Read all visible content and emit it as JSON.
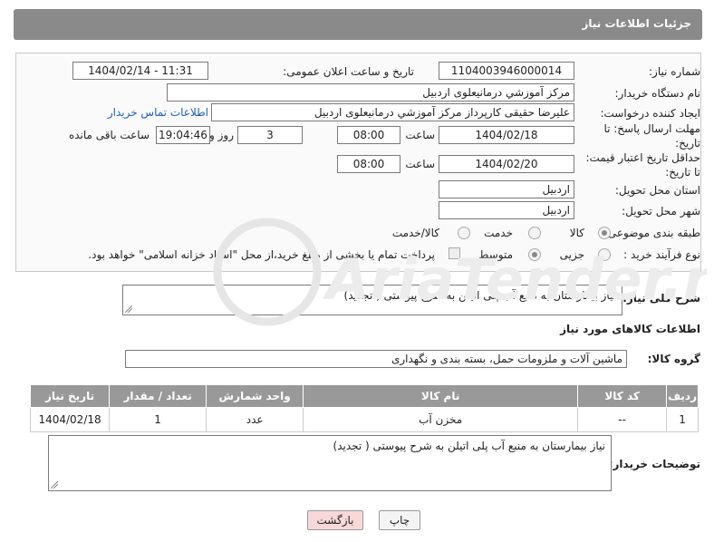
{
  "header": {
    "title": "جزئیات اطلاعات نیاز"
  },
  "form": {
    "need_number_label": "شماره نیاز:",
    "need_number": "1104003946000014",
    "announce_label": "تاریخ و ساعت اعلان عمومی:",
    "announce_value": "1404/02/14 - 11:31",
    "buyer_org_label": "نام دستگاه خریدار:",
    "buyer_org": "مرکز آموزشي درمانيعلوی اردبیل",
    "requester_label": "ایجاد کننده درخواست:",
    "requester": "علیرضا حقیقی کارپرداز مرکز آموزشي درمانيعلوی اردبیل",
    "contact_link": "اطلاعات تماس خریدار",
    "reply_deadline_label": "مهلت ارسال پاسخ: تا تاریخ:",
    "reply_date": "1404/02/18",
    "time_label": "ساعت",
    "reply_time": "08:00",
    "days": "3",
    "days_label": "روز و",
    "remaining_time": "19:04:46",
    "remaining_label": "ساعت باقی مانده",
    "price_validity_label": "حداقل تاریخ اعتبار قیمت: تا تاریخ:",
    "price_date": "1404/02/20",
    "price_time": "08:00",
    "province_label": "استان محل تحویل:",
    "province": "اردبیل",
    "city_label": "شهر محل تحویل:",
    "city": "اردبیل",
    "category_label": "طبقه بندی موضوعی:",
    "category_options": [
      "کالا",
      "خدمت",
      "کالا/خدمت"
    ],
    "process_label": "نوع فرآیند خرید :",
    "process_options": [
      "جزیی",
      "متوسط"
    ],
    "payment_note": "پرداخت تمام یا بخشی از مبلغ خرید،از محل \"اسناد خزانه اسلامی\" خواهد بود."
  },
  "description": {
    "label": "شرح کلی نیاز:",
    "text": "نیاز بیمارستان به منبع آب پلی اتیلن به شرح پیوستی ( تجدید)"
  },
  "goods": {
    "section_title": "اطلاعات کالاهای مورد نیاز",
    "group_label": "گروه کالا:",
    "group_value": "ماشین آلات و ملزومات حمل، بسته بندی و نگهداری",
    "columns": [
      "ردیف",
      "کد کالا",
      "نام کالا",
      "واحد شمارش",
      "تعداد / مقدار",
      "تاریخ نیاز"
    ],
    "rows": [
      {
        "row": "1",
        "code": "--",
        "name": "مخزن آب",
        "unit": "عدد",
        "qty": "1",
        "date": "1404/02/18"
      }
    ]
  },
  "buyer_notes": {
    "label": "توضیحات خریدار:",
    "text": "نیاز بیمارستان به منبع آب پلی اتیلن به شرح پیوستی ( تجدید)"
  },
  "buttons": {
    "print": "چاپ",
    "back": "بازگشت"
  },
  "watermark": {
    "text": "AriaTender.neT"
  },
  "colors": {
    "header": "#8a8a8a",
    "table_header": "#999999",
    "link": "#2060b0",
    "back_button": "#f8d8d8"
  }
}
